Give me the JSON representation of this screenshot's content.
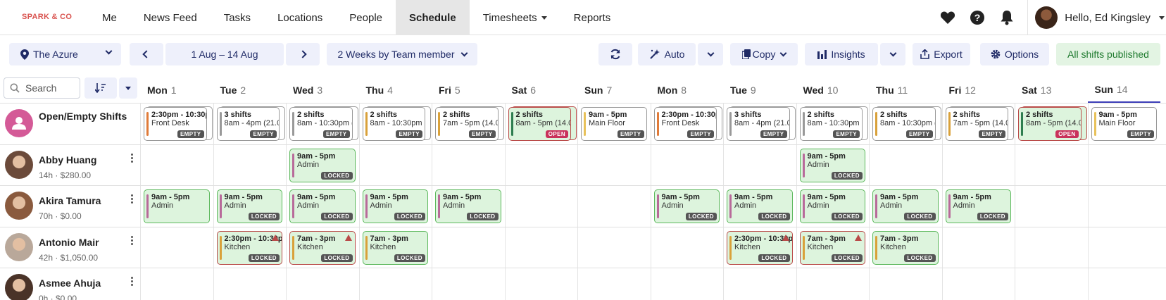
{
  "brand": "SPARK & CO",
  "nav": [
    {
      "label": "Me",
      "active": false
    },
    {
      "label": "News Feed",
      "active": false
    },
    {
      "label": "Tasks",
      "active": false
    },
    {
      "label": "Locations",
      "active": false
    },
    {
      "label": "People",
      "active": false
    },
    {
      "label": "Schedule",
      "active": true
    },
    {
      "label": "Timesheets",
      "active": false,
      "dropdown": true
    },
    {
      "label": "Reports",
      "active": false
    }
  ],
  "user": {
    "greeting": "Hello, Ed Kingsley"
  },
  "toolbar": {
    "location": "The Azure",
    "date_range": "1 Aug – 14 Aug",
    "view": "2 Weeks by Team member",
    "auto": "Auto",
    "copy": "Copy",
    "insights": "Insights",
    "export": "Export",
    "options": "Options",
    "published": "All shifts published"
  },
  "search": {
    "placeholder": "Search"
  },
  "days": [
    {
      "name": "Mon",
      "date": "1"
    },
    {
      "name": "Tue",
      "date": "2"
    },
    {
      "name": "Wed",
      "date": "3"
    },
    {
      "name": "Thu",
      "date": "4"
    },
    {
      "name": "Fri",
      "date": "5"
    },
    {
      "name": "Sat",
      "date": "6"
    },
    {
      "name": "Sun",
      "date": "7"
    },
    {
      "name": "Mon",
      "date": "8"
    },
    {
      "name": "Tue",
      "date": "9"
    },
    {
      "name": "Wed",
      "date": "10"
    },
    {
      "name": "Thu",
      "date": "11"
    },
    {
      "name": "Fri",
      "date": "12"
    },
    {
      "name": "Sat",
      "date": "13"
    },
    {
      "name": "Sun",
      "date": "14",
      "today": true
    }
  ],
  "rows": [
    {
      "name": "Open/Empty Shifts",
      "meta": "",
      "type": "open",
      "shifts": [
        {
          "day": 0,
          "t1": "2:30pm - 10:30pm",
          "t2": "Front Desk",
          "badge": "EMPTY",
          "style": "white",
          "stacked": true,
          "bar": "#e07b39"
        },
        {
          "day": 1,
          "t1": "3 shifts",
          "t2": "8am - 4pm (21.0",
          "badge": "EMPTY",
          "style": "white",
          "stacked": true,
          "bar": "#999999"
        },
        {
          "day": 2,
          "t1": "2 shifts",
          "t2": "8am - 10:30pm (",
          "badge": "EMPTY",
          "style": "white",
          "stacked": true,
          "bar": "#999999"
        },
        {
          "day": 3,
          "t1": "2 shifts",
          "t2": "8am - 10:30pm (",
          "badge": "EMPTY",
          "style": "white",
          "stacked": true,
          "bar": "#d9a13a"
        },
        {
          "day": 4,
          "t1": "2 shifts",
          "t2": "7am - 5pm (14.0",
          "badge": "EMPTY",
          "style": "white",
          "stacked": true,
          "bar": "#d9a13a"
        },
        {
          "day": 5,
          "t1": "2 shifts",
          "t2": "8am - 5pm (14.0",
          "badge": "OPEN",
          "style": "green",
          "stacked": true,
          "bar": "#2e7d4f"
        },
        {
          "day": 6,
          "t1": "9am - 5pm",
          "t2": "Main Floor",
          "badge": "EMPTY",
          "style": "white",
          "stacked": false,
          "bar": "#e8c15a"
        },
        {
          "day": 7,
          "t1": "2:30pm - 10:30pm",
          "t2": "Front Desk",
          "badge": "EMPTY",
          "style": "white",
          "stacked": true,
          "bar": "#e07b39"
        },
        {
          "day": 8,
          "t1": "3 shifts",
          "t2": "8am - 4pm (21.0",
          "badge": "EMPTY",
          "style": "white",
          "stacked": true,
          "bar": "#999999"
        },
        {
          "day": 9,
          "t1": "2 shifts",
          "t2": "8am - 10:30pm (",
          "badge": "EMPTY",
          "style": "white",
          "stacked": true,
          "bar": "#999999"
        },
        {
          "day": 10,
          "t1": "2 shifts",
          "t2": "8am - 10:30pm (",
          "badge": "EMPTY",
          "style": "white",
          "stacked": true,
          "bar": "#d9a13a"
        },
        {
          "day": 11,
          "t1": "2 shifts",
          "t2": "7am - 5pm (14.0",
          "badge": "EMPTY",
          "style": "white",
          "stacked": true,
          "bar": "#d9a13a"
        },
        {
          "day": 12,
          "t1": "2 shifts",
          "t2": "8am - 5pm (14.0",
          "badge": "OPEN",
          "style": "green",
          "stacked": true,
          "bar": "#2e7d4f"
        },
        {
          "day": 13,
          "t1": "9am - 5pm",
          "t2": "Main Floor",
          "badge": "EMPTY",
          "style": "white",
          "stacked": false,
          "bar": "#e8c15a"
        }
      ]
    },
    {
      "name": "Abby Huang",
      "meta": "14h · $280.00",
      "avatar": "#6b4a3a",
      "shifts": [
        {
          "day": 2,
          "t1": "9am - 5pm",
          "t2": "Admin",
          "badge": "LOCKED",
          "style": "green",
          "bar": "#b86a9a"
        },
        {
          "day": 9,
          "t1": "9am - 5pm",
          "t2": "Admin",
          "badge": "LOCKED",
          "style": "green",
          "bar": "#b86a9a"
        }
      ]
    },
    {
      "name": "Akira Tamura",
      "meta": "70h · $0.00",
      "avatar": "#8a5a3e",
      "shifts": [
        {
          "day": 0,
          "t1": "9am - 5pm",
          "t2": "Admin",
          "badge": "",
          "style": "green",
          "bar": "#b86a9a"
        },
        {
          "day": 1,
          "t1": "9am - 5pm",
          "t2": "Admin",
          "badge": "LOCKED",
          "style": "green",
          "bar": "#b86a9a"
        },
        {
          "day": 2,
          "t1": "9am - 5pm",
          "t2": "Admin",
          "badge": "LOCKED",
          "style": "green",
          "bar": "#b86a9a"
        },
        {
          "day": 3,
          "t1": "9am - 5pm",
          "t2": "Admin",
          "badge": "LOCKED",
          "style": "green",
          "bar": "#b86a9a"
        },
        {
          "day": 4,
          "t1": "9am - 5pm",
          "t2": "Admin",
          "badge": "LOCKED",
          "style": "green",
          "bar": "#b86a9a"
        },
        {
          "day": 7,
          "t1": "9am - 5pm",
          "t2": "Admin",
          "badge": "LOCKED",
          "style": "green",
          "bar": "#b86a9a"
        },
        {
          "day": 8,
          "t1": "9am - 5pm",
          "t2": "Admin",
          "badge": "LOCKED",
          "style": "green",
          "bar": "#b86a9a"
        },
        {
          "day": 9,
          "t1": "9am - 5pm",
          "t2": "Admin",
          "badge": "LOCKED",
          "style": "green",
          "bar": "#b86a9a"
        },
        {
          "day": 10,
          "t1": "9am - 5pm",
          "t2": "Admin",
          "badge": "LOCKED",
          "style": "green",
          "bar": "#b86a9a"
        },
        {
          "day": 11,
          "t1": "9am - 5pm",
          "t2": "Admin",
          "badge": "LOCKED",
          "style": "green",
          "bar": "#b86a9a"
        }
      ]
    },
    {
      "name": "Antonio Mair",
      "meta": "42h · $1,050.00",
      "avatar": "#b9a89a",
      "shifts": [
        {
          "day": 1,
          "t1": "2:30pm - 10:30pm",
          "t2": "Kitchen",
          "badge": "LOCKED",
          "style": "green",
          "warn": true,
          "bar": "#d9a13a"
        },
        {
          "day": 2,
          "t1": "7am - 3pm",
          "t2": "Kitchen",
          "badge": "LOCKED",
          "style": "green",
          "warn": true,
          "bar": "#d9a13a"
        },
        {
          "day": 3,
          "t1": "7am - 3pm",
          "t2": "Kitchen",
          "badge": "LOCKED",
          "style": "green",
          "warn": false,
          "bar": "#d9a13a"
        },
        {
          "day": 8,
          "t1": "2:30pm - 10:30pm",
          "t2": "Kitchen",
          "badge": "LOCKED",
          "style": "green",
          "warn": true,
          "bar": "#d9a13a"
        },
        {
          "day": 9,
          "t1": "7am - 3pm",
          "t2": "Kitchen",
          "badge": "LOCKED",
          "style": "green",
          "warn": true,
          "bar": "#d9a13a"
        },
        {
          "day": 10,
          "t1": "7am - 3pm",
          "t2": "Kitchen",
          "badge": "LOCKED",
          "style": "green",
          "warn": false,
          "bar": "#d9a13a"
        }
      ]
    },
    {
      "name": "Asmee Ahuja",
      "meta": "0h · $0.00",
      "avatar": "#4a3328",
      "shifts": []
    }
  ]
}
